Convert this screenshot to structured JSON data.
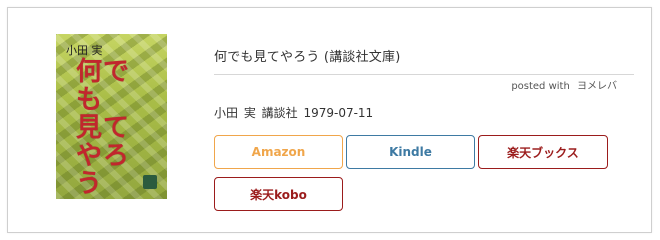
{
  "book": {
    "title": "何でも見てやろう (講談社文庫)",
    "cover": {
      "author": "小田 実",
      "title_vertical": "何でも\n見て\nやろう"
    },
    "meta": "小田 実 講談社 1979-07-11"
  },
  "posted": {
    "prefix": "posted with",
    "brand": "ヨメレバ"
  },
  "buttons": {
    "amazon": "Amazon",
    "kindle": "Kindle",
    "rakuten_books": "楽天ブックス",
    "rakuten_kobo": "楽天kobo"
  },
  "colors": {
    "amazon": "#f0a64b",
    "kindle": "#3e7aa3",
    "rakuten": "#9b1c1c",
    "cover_bg": "#b9c95a",
    "cover_title": "#c1272d"
  }
}
